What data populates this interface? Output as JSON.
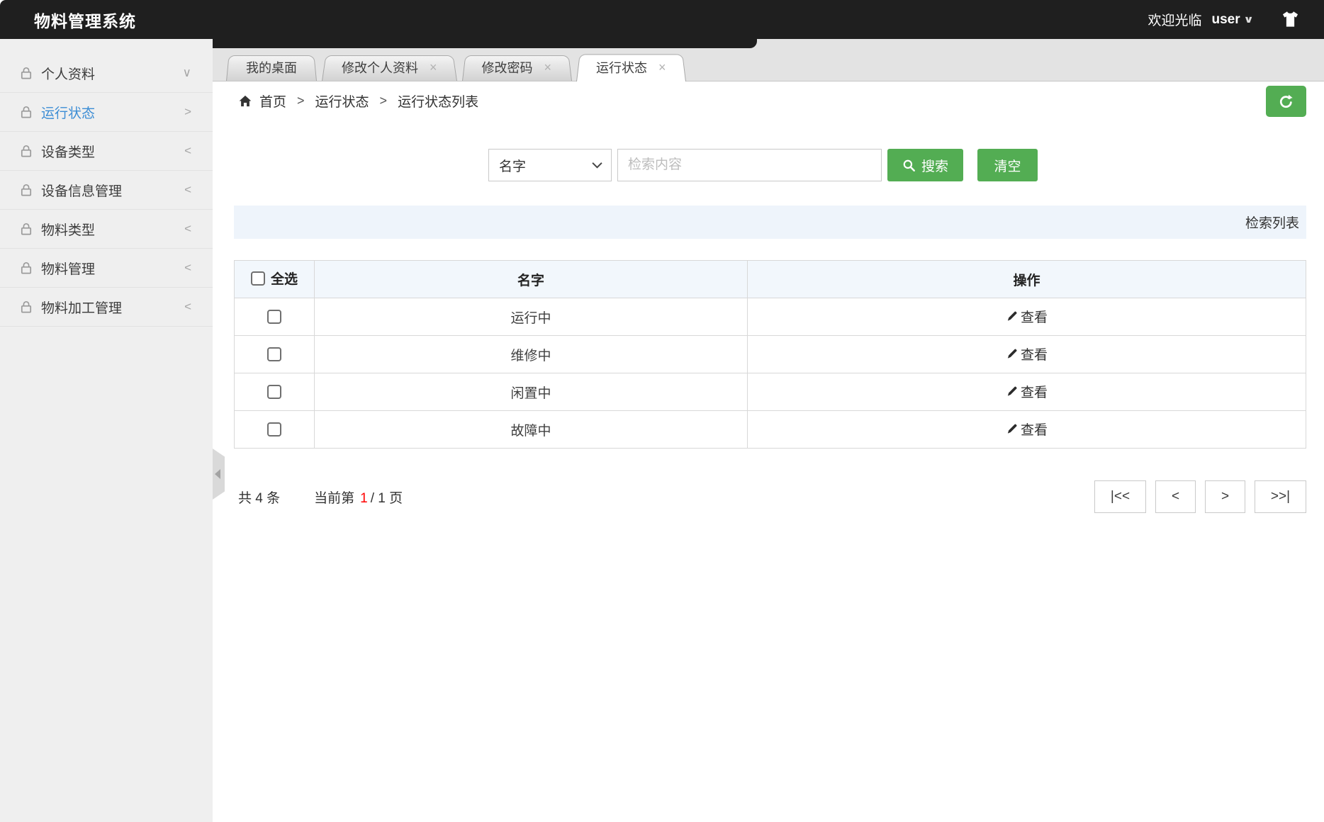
{
  "header": {
    "title": "物料管理系统",
    "welcome": "欢迎光临",
    "username": "user"
  },
  "sidebar": {
    "items": [
      {
        "label": "个人资料",
        "icon": "lock-icon",
        "chevron": "∨",
        "active": false
      },
      {
        "label": "运行状态",
        "icon": "lock-icon",
        "chevron": ">",
        "active": true
      },
      {
        "label": "设备类型",
        "icon": "lock-icon",
        "chevron": "<",
        "active": false
      },
      {
        "label": "设备信息管理",
        "icon": "lock-icon",
        "chevron": "<",
        "active": false
      },
      {
        "label": "物料类型",
        "icon": "lock-icon",
        "chevron": "<",
        "active": false
      },
      {
        "label": "物料管理",
        "icon": "lock-icon",
        "chevron": "<",
        "active": false
      },
      {
        "label": "物料加工管理",
        "icon": "lock-icon",
        "chevron": "<",
        "active": false
      }
    ]
  },
  "tabs": [
    {
      "label": "我的桌面",
      "closable": false,
      "active": false
    },
    {
      "label": "修改个人资料",
      "closable": true,
      "active": false
    },
    {
      "label": "修改密码",
      "closable": true,
      "active": false
    },
    {
      "label": "运行状态",
      "closable": true,
      "active": true
    }
  ],
  "breadcrumb": {
    "separator": ">",
    "items": [
      "首页",
      "运行状态",
      "运行状态列表"
    ]
  },
  "search": {
    "field_value": "名字",
    "input_value": "",
    "input_placeholder": "检索内容",
    "search_label": "搜索",
    "clear_label": "清空"
  },
  "list_panel": {
    "header": "检索列表"
  },
  "table": {
    "select_all_label": "全选",
    "columns": {
      "name": "名字",
      "action": "操作"
    },
    "action_label": "查看",
    "rows": [
      {
        "name": "运行中"
      },
      {
        "name": "维修中"
      },
      {
        "name": "闲置中"
      },
      {
        "name": "故障中"
      }
    ]
  },
  "pagination": {
    "total_text": "共 4 条",
    "current_prefix": "当前第",
    "current_page": "1",
    "page_suffix": "/ 1 页",
    "first_label": "|<<",
    "prev_label": "<",
    "next_label": ">",
    "last_label": ">>|"
  },
  "colors": {
    "header_bg": "#1f1f1f",
    "accent_green": "#53ad53",
    "active_menu_blue": "#3c8dd5",
    "current_page_red": "#ff0000",
    "table_header_bg": "#f2f7fc",
    "list_bar_bg": "#eef4fb"
  }
}
